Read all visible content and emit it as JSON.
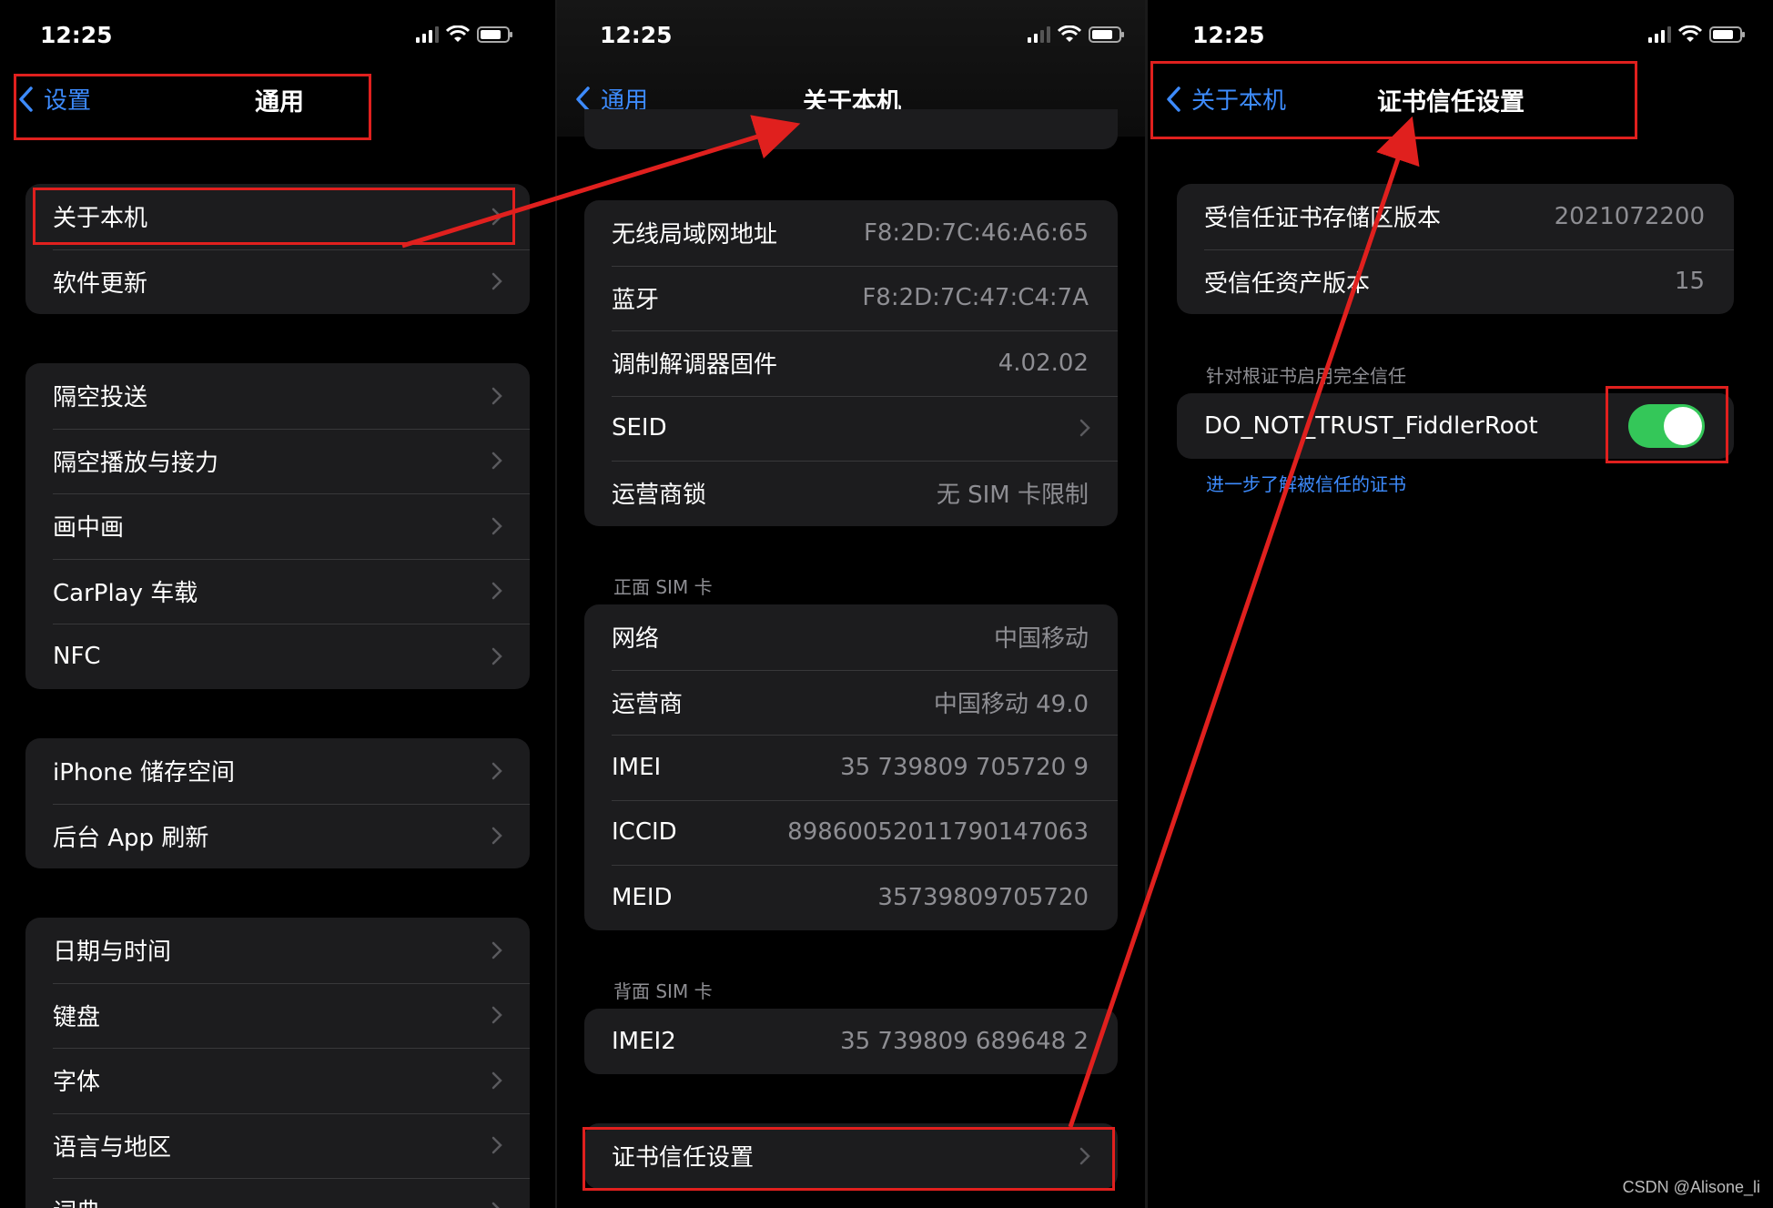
{
  "status_bar": {
    "time": "12:25"
  },
  "panel_general": {
    "nav": {
      "back_label": "设置",
      "title": "通用"
    },
    "groups": [
      [
        {
          "label": "关于本机"
        },
        {
          "label": "软件更新"
        }
      ],
      [
        {
          "label": "隔空投送"
        },
        {
          "label": "隔空播放与接力"
        },
        {
          "label": "画中画"
        },
        {
          "label": "CarPlay 车载"
        },
        {
          "label": "NFC"
        }
      ],
      [
        {
          "label": "iPhone 储存空间"
        },
        {
          "label": "后台 App 刷新"
        }
      ],
      [
        {
          "label": "日期与时间"
        },
        {
          "label": "键盘"
        },
        {
          "label": "字体"
        },
        {
          "label": "语言与地区"
        },
        {
          "label": "词典"
        }
      ]
    ]
  },
  "panel_about": {
    "nav": {
      "back_label": "通用",
      "title": "关于本机"
    },
    "network_group": [
      {
        "label": "无线局域网地址",
        "value": "F8:2D:7C:46:A6:65"
      },
      {
        "label": "蓝牙",
        "value": "F8:2D:7C:47:C4:7A"
      },
      {
        "label": "调制解调器固件",
        "value": "4.02.02"
      },
      {
        "label": "SEID",
        "value": ""
      },
      {
        "label": "运营商锁",
        "value": "无 SIM 卡限制"
      }
    ],
    "front_sim": {
      "title": "正面 SIM 卡",
      "rows": [
        {
          "label": "网络",
          "value": "中国移动"
        },
        {
          "label": "运营商",
          "value": "中国移动 49.0"
        },
        {
          "label": "IMEI",
          "value": "35 739809 705720 9"
        },
        {
          "label": "ICCID",
          "value": "89860052011790147063"
        },
        {
          "label": "MEID",
          "value": "35739809705720"
        }
      ]
    },
    "back_sim": {
      "title": "背面 SIM 卡",
      "rows": [
        {
          "label": "IMEI2",
          "value": "35 739809 689648 2"
        }
      ]
    },
    "cert_row": {
      "label": "证书信任设置"
    }
  },
  "panel_cert": {
    "nav": {
      "back_label": "关于本机",
      "title": "证书信任设置"
    },
    "info_group": [
      {
        "label": "受信任证书存储区版本",
        "value": "2021072200"
      },
      {
        "label": "受信任资产版本",
        "value": "15"
      }
    ],
    "section_title": "针对根证书启用完全信任",
    "cert_toggle": {
      "label": "DO_NOT_TRUST_FiddlerRoot",
      "on": true
    },
    "learn_more": "进一步了解被信任的证书"
  },
  "colors": {
    "accent": "#3d8bfd",
    "toggle_on": "#34c759",
    "highlight": "#e0201e",
    "cell_bg": "#1c1c1e"
  },
  "watermark": "CSDN @Alisone_li"
}
